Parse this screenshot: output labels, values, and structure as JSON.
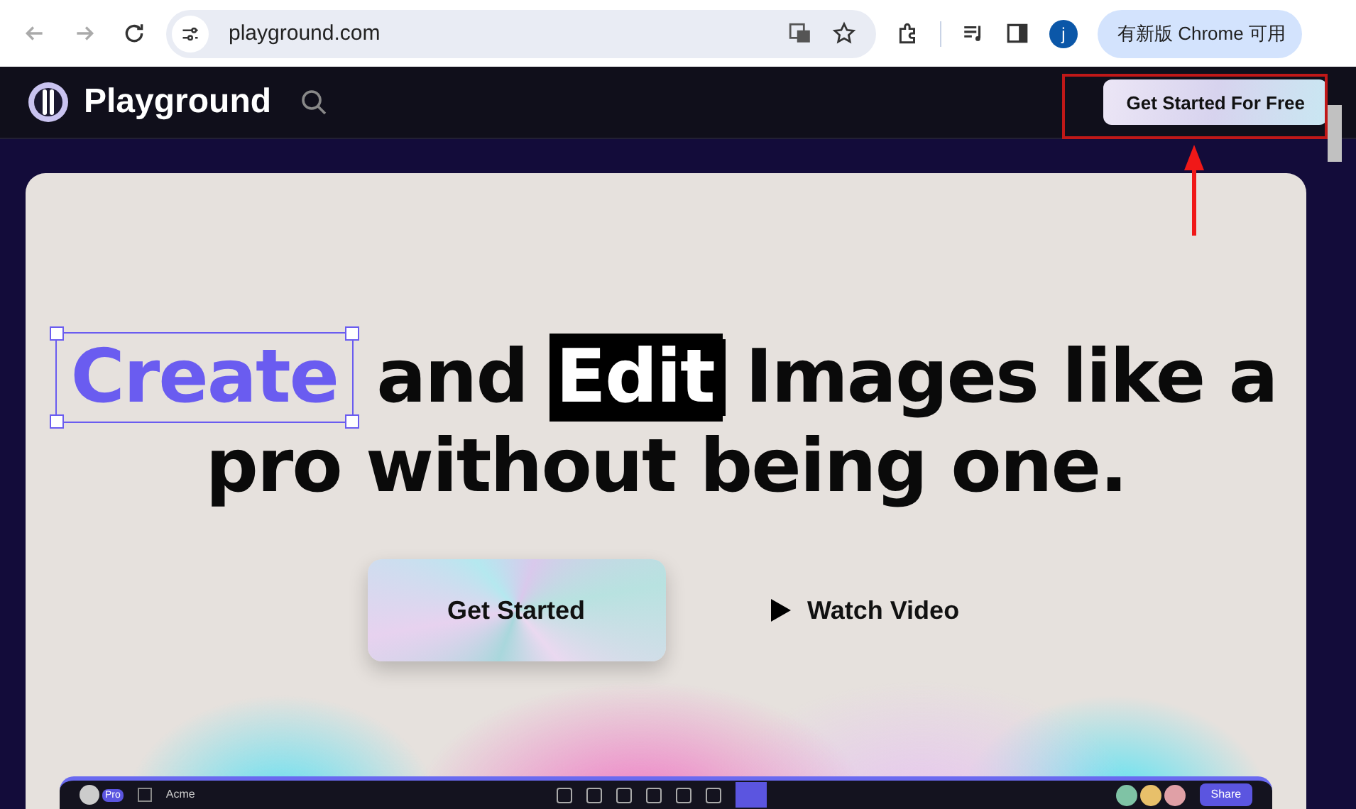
{
  "browser": {
    "url": "playground.com",
    "update_button": "有新版 Chrome 可用",
    "profile_initial": "j"
  },
  "nav": {
    "brand": "Playground",
    "cta": "Get Started For Free"
  },
  "hero": {
    "lines": [
      [
        {
          "text": "Create",
          "kind": "selected"
        },
        {
          "text": "and",
          "kind": "plain"
        },
        {
          "text": "Edit",
          "kind": "highlight"
        },
        {
          "text": "Images like a",
          "kind": "plain"
        }
      ],
      [
        {
          "text": "pro without being one.",
          "kind": "plain"
        }
      ]
    ],
    "buttons": [
      {
        "label": "Get Started",
        "kind": "primary"
      },
      {
        "label": "Watch Video",
        "kind": "video"
      }
    ]
  },
  "preview": {
    "badge": "Pro",
    "project": "Acme",
    "share": "Share"
  }
}
